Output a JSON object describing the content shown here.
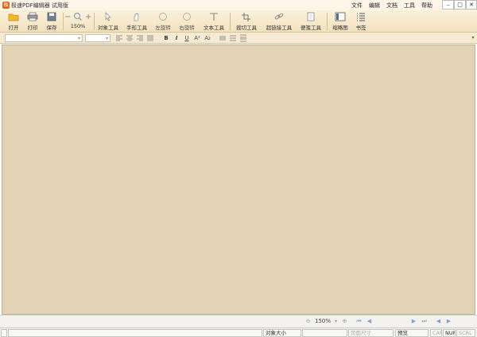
{
  "app": {
    "logo_glyph": "极",
    "title": "极速PDF编辑器 试用版"
  },
  "menu": [
    "文件",
    "编辑",
    "文档",
    "工具",
    "帮助"
  ],
  "window_controls": [
    "–",
    "□",
    "✕"
  ],
  "toolbar": {
    "open": "打开",
    "print": "打印",
    "save": "保存",
    "zoom_minus": "−",
    "zoom_plus": "+",
    "zoom_level": "150%",
    "object_tool": "对象工具",
    "hand_tool": "手形工具",
    "rotate_left": "左旋转",
    "rotate_right": "右旋转",
    "text_tool": "文本工具",
    "crop_tool": "裁切工具",
    "link_tool": "超链接工具",
    "note_tool": "便笺工具",
    "thumbnails": "缩略图",
    "bookmarks": "书签"
  },
  "format": {
    "bold": "B",
    "italic": "I",
    "underline": "U",
    "superscript": "A²",
    "subscript": "A₂"
  },
  "nav": {
    "zoom_value": "150%"
  },
  "status": {
    "object_size": "对象大小",
    "page_size": "页面尺寸",
    "preview": "预览",
    "cap": "CAP",
    "num": "NUM",
    "scrl": "SCRL"
  },
  "colors": {
    "accent": "#e0641c",
    "workspace": "#e3d3b6",
    "toolbar": "#f5e6c6"
  }
}
